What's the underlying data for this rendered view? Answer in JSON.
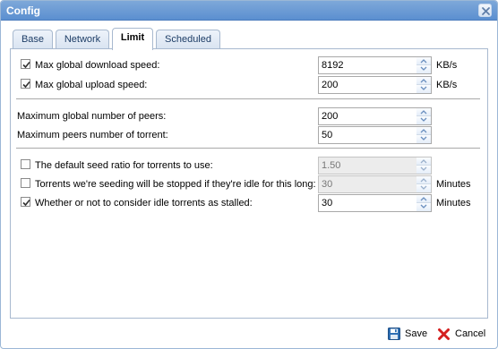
{
  "window": {
    "title": "Config"
  },
  "tabs": [
    {
      "label": "Base",
      "active": false
    },
    {
      "label": "Network",
      "active": false
    },
    {
      "label": "Limit",
      "active": true
    },
    {
      "label": "Scheduled",
      "active": false
    }
  ],
  "limit": {
    "download": {
      "label": "Max global download speed:",
      "checked": true,
      "value": "8192",
      "unit": "KB/s"
    },
    "upload": {
      "label": "Max global upload speed:",
      "checked": true,
      "value": "200",
      "unit": "KB/s"
    },
    "peers_global": {
      "label": "Maximum global number of peers:",
      "value": "200"
    },
    "peers_torrent": {
      "label": "Maximum peers number of torrent:",
      "value": "50"
    },
    "seed_ratio": {
      "label": "The default seed ratio for torrents to use:",
      "checked": false,
      "value": "1.50",
      "disabled": true
    },
    "idle_stop": {
      "label": "Torrents we're seeding will be stopped if they're idle for this long:",
      "checked": false,
      "value": "30",
      "unit": "Minutes",
      "disabled": true
    },
    "idle_stalled": {
      "label": "Whether or not to consider idle torrents as stalled:",
      "checked": true,
      "value": "30",
      "unit": "Minutes"
    }
  },
  "footer": {
    "save_label": "Save",
    "cancel_label": "Cancel"
  },
  "colors": {
    "titlebar": "#6a9bd6",
    "save_icon": "#2f6fb4",
    "cancel_icon": "#d42020"
  },
  "icons": {
    "close": "close-icon",
    "save": "save-icon",
    "cancel": "cancel-icon",
    "check": "checkmark-icon"
  }
}
